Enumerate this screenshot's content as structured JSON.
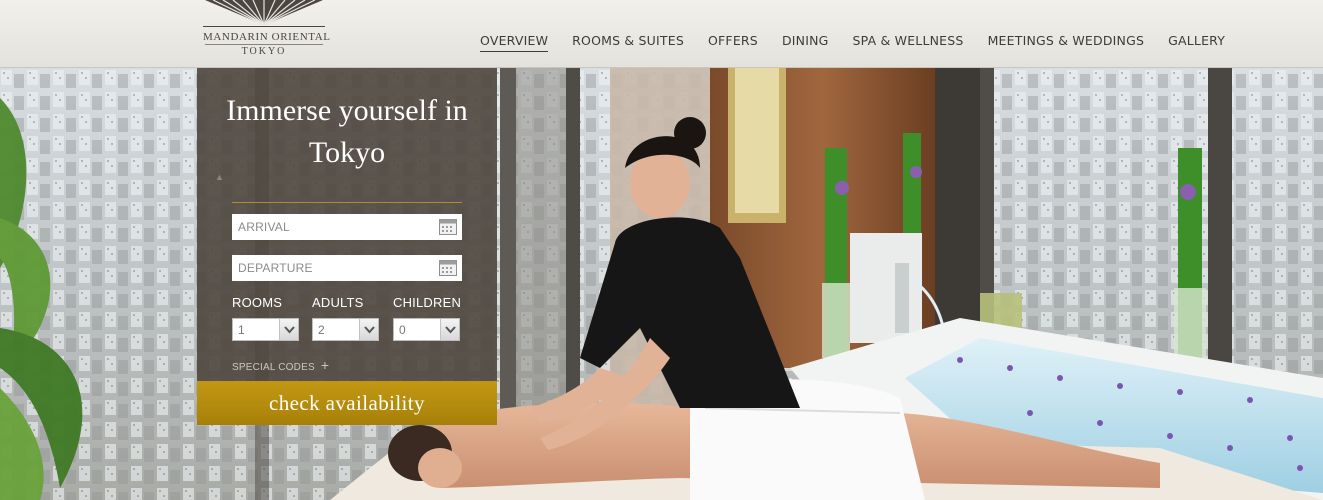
{
  "brand": {
    "name": "MANDARIN ORIENTAL",
    "city": "TOKYO"
  },
  "nav": [
    {
      "label": "OVERVIEW",
      "active": true
    },
    {
      "label": "ROOMS & SUITES",
      "active": false
    },
    {
      "label": "OFFERS",
      "active": false
    },
    {
      "label": "DINING",
      "active": false
    },
    {
      "label": "SPA & WELLNESS",
      "active": false
    },
    {
      "label": "MEETINGS & WEDDINGS",
      "active": false
    },
    {
      "label": "GALLERY",
      "active": false
    }
  ],
  "booking": {
    "title": "Immerse yourself in Tokyo",
    "arrival_placeholder": "ARRIVAL",
    "departure_placeholder": "DEPARTURE",
    "rooms_label": "ROOMS",
    "adults_label": "ADULTS",
    "children_label": "CHILDREN",
    "rooms_value": "1",
    "adults_value": "2",
    "children_value": "0",
    "special_codes_label": "SPECIAL CODES",
    "special_codes_icon": "plus-icon",
    "submit_label": "check availability"
  },
  "colors": {
    "header_bg": "#ebe9e4",
    "panel_bg": "#4e463e",
    "accent_gold": "#b48c0e",
    "nav_text": "#3f3c37"
  }
}
